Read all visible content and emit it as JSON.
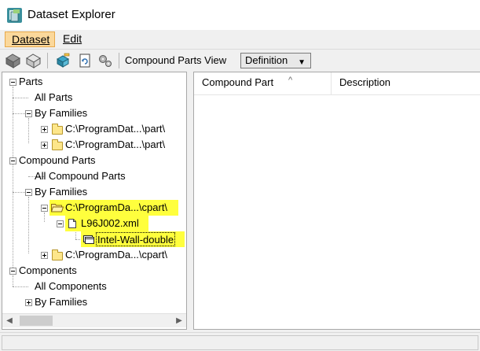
{
  "window": {
    "title": "Dataset Explorer",
    "icon": "dataset-app-icon"
  },
  "menubar": {
    "items": [
      {
        "label": "Dataset",
        "active": true
      },
      {
        "label": "Edit",
        "active": false
      }
    ]
  },
  "toolbar": {
    "buttons": [
      "parts-gray-icon",
      "parts-white-icon",
      "edit-part-icon",
      "refresh-icon",
      "gears-icon"
    ],
    "view_label": "Compound Parts View",
    "view_value": "Definition"
  },
  "tree": {
    "nodes": [
      {
        "label": "Parts",
        "level": 0,
        "expander": "minus"
      },
      {
        "label": "All Parts",
        "level": 1
      },
      {
        "label": "By Families",
        "level": 1,
        "expander": "minus"
      },
      {
        "label": "C:\\ProgramDat...\\part\\",
        "level": 2,
        "expander": "plus",
        "icon": "folder-icon"
      },
      {
        "label": "C:\\ProgramDat...\\part\\",
        "level": 2,
        "expander": "plus",
        "icon": "folder-icon"
      },
      {
        "label": "Compound Parts",
        "level": 0,
        "expander": "minus"
      },
      {
        "label": "All Compound Parts",
        "level": 1
      },
      {
        "label": "By Families",
        "level": 1,
        "expander": "minus"
      },
      {
        "label": "C:\\ProgramDa...\\cpart\\",
        "level": 2,
        "expander": "minus",
        "icon": "folder-open-icon",
        "highlight": true
      },
      {
        "label": "L96J002.xml",
        "level": 3,
        "expander": "minus",
        "icon": "file-icon",
        "highlight": true
      },
      {
        "label": "Intel-Wall-double",
        "level": 4,
        "icon": "compound-part-icon",
        "highlight": true,
        "selected": true
      },
      {
        "label": "C:\\ProgramDa...\\cpart\\",
        "level": 2,
        "expander": "plus",
        "icon": "folder-icon"
      },
      {
        "label": "Components",
        "level": 0,
        "expander": "minus"
      },
      {
        "label": "All Components",
        "level": 1
      },
      {
        "label": "By Families",
        "level": 1,
        "expander": "plus"
      }
    ],
    "highlight_color": "#ffff3d"
  },
  "list": {
    "columns": [
      "Compound Part",
      "Description"
    ],
    "sort_indicator": "^",
    "rows": []
  },
  "colors": {
    "menu_active_bg": "#fbd89b",
    "folder_fill": "#fde68a"
  }
}
